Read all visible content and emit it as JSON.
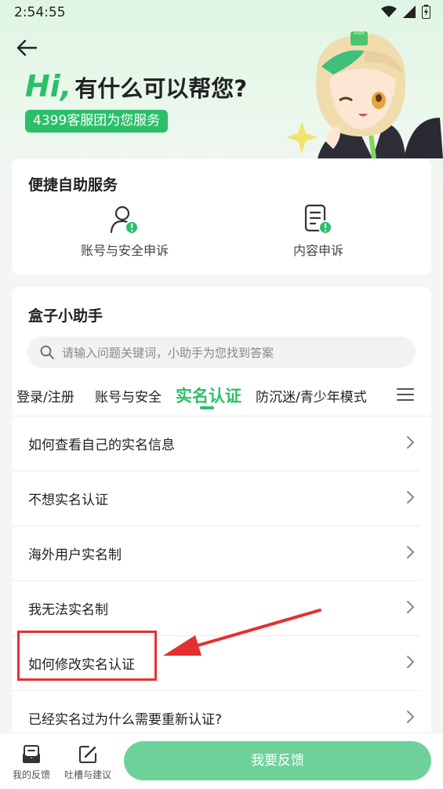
{
  "status": {
    "time": "2:54:55"
  },
  "hero": {
    "hi": "Hi,",
    "question": "有什么可以帮您?",
    "badge": "4399客服团为您服务"
  },
  "self_service": {
    "title": "便捷自助服务",
    "items": [
      {
        "label": "账号与安全申诉",
        "icon": "user-alert-icon"
      },
      {
        "label": "内容申诉",
        "icon": "document-alert-icon"
      }
    ]
  },
  "assistant": {
    "title": "盒子小助手",
    "search_placeholder": "请输入问题关键词，小助手为您找到答案",
    "tabs": [
      "登录/注册",
      "账号与安全",
      "实名认证",
      "防沉迷/青少年模式"
    ],
    "active_tab": "实名认证",
    "questions": [
      "如何查看自己的实名信息",
      "不想实名认证",
      "海外用户实名制",
      "我无法实名制",
      "如何修改实名认证",
      "已经实名过为什么需要重新认证?"
    ]
  },
  "bottom_bar": {
    "my_feedback": "我的反馈",
    "suggest": "吐槽与建议",
    "feedback_button": "我要反馈"
  },
  "colors": {
    "accent": "#2cbf6a",
    "highlight": "#e53030"
  }
}
